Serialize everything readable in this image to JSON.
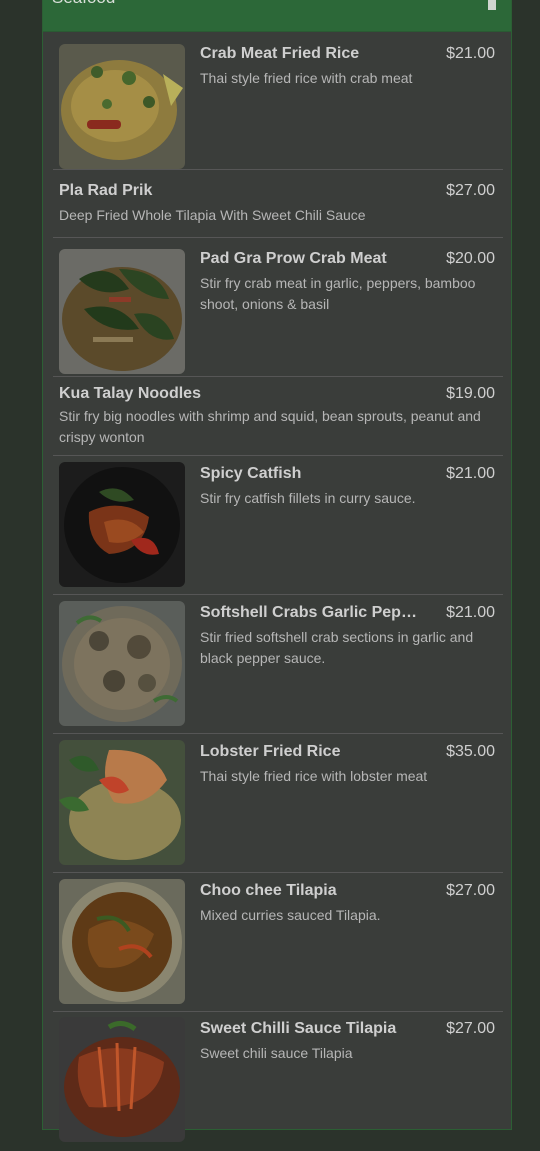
{
  "panel": {
    "title": "Seafood",
    "scroll_top_icon": "arrow-up-icon"
  },
  "items": [
    {
      "name": "Crab Meat Fried Rice",
      "price": "$21.00",
      "desc": "Thai style fried rice with crab meat"
    },
    {
      "name": "Pla Rad Prik",
      "price": "$27.00",
      "desc": "Deep Fried Whole Tilapia With Sweet Chili Sauce"
    },
    {
      "name": "Pad Gra Prow Crab Meat",
      "price": "$20.00",
      "desc": "Stir fry crab meat in garlic, peppers, bamboo shoot, onions & basil"
    },
    {
      "name": "Kua Talay Noodles",
      "price": "$19.00",
      "desc": "Stir fry big noodles with shrimp and squid, bean sprouts, peanut and crispy wonton"
    },
    {
      "name": "Spicy Catfish",
      "price": "$21.00",
      "desc": "Stir fry catfish fillets in curry sauce."
    },
    {
      "name": "Softshell Crabs Garlic Pepper",
      "price": "$21.00",
      "desc": "Stir fried softshell crab sections in garlic and black pepper sauce."
    },
    {
      "name": "Lobster Fried Rice",
      "price": "$35.00",
      "desc": "Thai style fried rice with lobster meat"
    },
    {
      "name": "Choo chee Tilapia",
      "price": "$27.00",
      "desc": "Mixed curries sauced Tilapia."
    },
    {
      "name": "Sweet Chilli Sauce Tilapia",
      "price": "$27.00",
      "desc": "Sweet chili sauce Tilapia"
    }
  ]
}
